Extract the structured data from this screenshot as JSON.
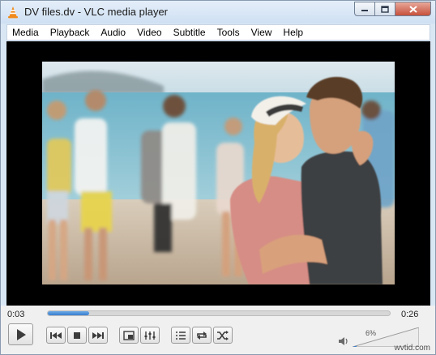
{
  "window": {
    "title": "DV files.dv - VLC media player",
    "icons": {
      "app": "vlc-cone-icon",
      "minimize": "minimize-icon",
      "maximize": "maximize-icon",
      "close": "close-icon"
    }
  },
  "menu": {
    "items": [
      {
        "label": "Media"
      },
      {
        "label": "Playback"
      },
      {
        "label": "Audio"
      },
      {
        "label": "Video"
      },
      {
        "label": "Subtitle"
      },
      {
        "label": "Tools"
      },
      {
        "label": "View"
      },
      {
        "label": "Help"
      }
    ]
  },
  "player": {
    "elapsed": "0:03",
    "duration": "0:26",
    "progress_fraction": 0.12,
    "volume_label": "6%",
    "volume_fraction": 0.06,
    "accent_color": "#3a7fcf"
  },
  "controls": {
    "buttons": [
      {
        "name": "play-button",
        "icon": "play-icon"
      },
      {
        "name": "previous-button",
        "icon": "skip-back-icon"
      },
      {
        "name": "stop-button",
        "icon": "stop-icon"
      },
      {
        "name": "next-button",
        "icon": "skip-forward-icon"
      },
      {
        "name": "fullscreen-button",
        "icon": "fullscreen-icon"
      },
      {
        "name": "extended-settings-button",
        "icon": "equalizer-icon"
      },
      {
        "name": "playlist-button",
        "icon": "playlist-icon"
      },
      {
        "name": "loop-button",
        "icon": "loop-icon"
      },
      {
        "name": "shuffle-button",
        "icon": "shuffle-icon"
      }
    ]
  },
  "watermark": "wvtid.com"
}
